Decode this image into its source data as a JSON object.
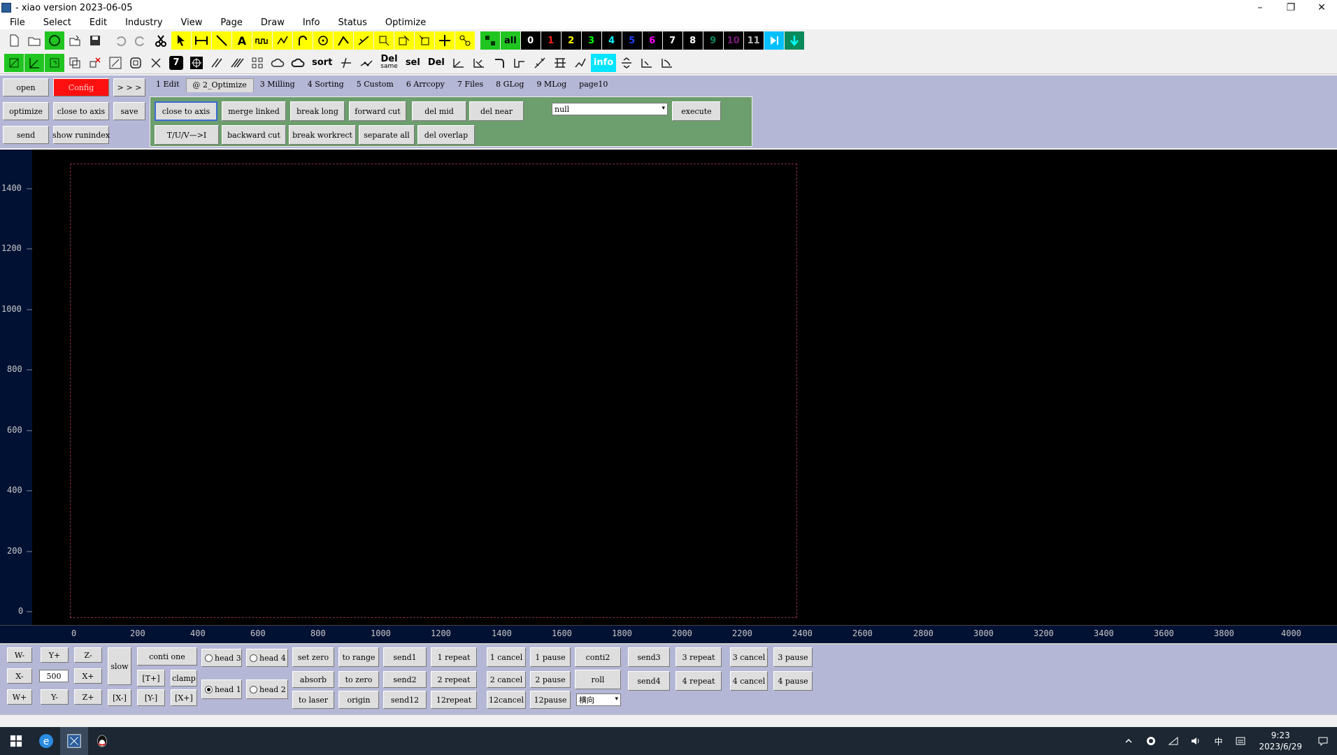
{
  "window": {
    "title": "- xiao version 2023-06-05",
    "controls": [
      "–",
      "❐",
      "✕"
    ]
  },
  "menu": [
    "File",
    "Select",
    "Edit",
    "Industry",
    "View",
    "Page",
    "Draw",
    "Info",
    "Status",
    "Optimize"
  ],
  "toolbar1": {
    "layers": [
      "0",
      "1",
      "2",
      "3",
      "4",
      "5",
      "6",
      "7",
      "8",
      "9",
      "10",
      "11"
    ],
    "all_label": "all"
  },
  "toolbar2": {
    "sort_label": "sort",
    "del_same_top": "Del",
    "del_same_bottom": "same",
    "sel_label": "sel",
    "del_label": "Del",
    "info_label": "info"
  },
  "left_panel": {
    "open": "open",
    "config": "Config",
    "more": "> > >",
    "optimize": "optimize",
    "close_to_axis": "close to axis",
    "save": "save",
    "send": "send",
    "show_runindex": "show runindex"
  },
  "tabs": [
    "1 Edit",
    "@ 2_Optimize",
    "3 Milling",
    "4 Sorting",
    "5 Custom",
    "6 Arrcopy",
    "7 Files",
    "8 GLog",
    "9 MLog",
    "page10"
  ],
  "optimize_panel": {
    "row1": [
      "close to axis",
      "merge linked",
      "break long",
      "forward cut",
      "del mid",
      "del near"
    ],
    "row2": [
      "T/U/V—>I",
      "backward cut",
      "break workrect",
      "separate all",
      "del overlap"
    ],
    "select_value": "null",
    "execute": "execute"
  },
  "canvas": {
    "y_ticks": [
      "1400",
      "1200",
      "1000",
      "800",
      "600",
      "400",
      "200",
      "0"
    ],
    "x_ticks": [
      "0",
      "200",
      "400",
      "600",
      "800",
      "1000",
      "1200",
      "1400",
      "1600",
      "1800",
      "2000",
      "2200",
      "2400",
      "2600",
      "2800",
      "3000",
      "3200",
      "3400",
      "3600",
      "3800",
      "4000"
    ]
  },
  "jog": {
    "w_minus": "W-",
    "y_plus": "Y+",
    "z_minus": "Z-",
    "x_minus": "X-",
    "step": "500",
    "x_plus": "X+",
    "w_plus": "W+",
    "y_minus": "Y-",
    "z_plus": "Z+",
    "slow": "slow",
    "conti_one": "conti one",
    "t_plus": "[T+]",
    "clamp": "clamp",
    "x_minus_b": "[X-]",
    "y_minus_b": "[Y-]",
    "x_plus_b": "[X+]"
  },
  "heads": {
    "head3": "head 3",
    "head4": "head 4",
    "head1": "head 1",
    "head2": "head 2"
  },
  "actions": {
    "set_zero": "set zero",
    "to_range": "to range",
    "send1": "send1",
    "repeat1": "1 repeat",
    "cancel1": "1 cancel",
    "pause1": "1 pause",
    "conti2": "conti2",
    "send3": "send3",
    "repeat3": "3 repeat",
    "cancel3": "3 cancel",
    "pause3": "3 pause",
    "absorb": "absorb",
    "to_zero": "to zero",
    "send2": "send2",
    "repeat2": "2 repeat",
    "cancel2": "2 cancel",
    "pause2": "2 pause",
    "roll": "roll",
    "send4": "send4",
    "repeat4": "4 repeat",
    "cancel4": "4 cancel",
    "pause4": "4 pause",
    "to_laser": "to laser",
    "origin": "origin",
    "send12": "send12",
    "repeat12": "12repeat",
    "cancel12": "12cancel",
    "pause12": "12pause",
    "direction_select": "横向"
  },
  "tray": {
    "ime": "中",
    "time": "9:23",
    "date": "2023/6/29"
  }
}
